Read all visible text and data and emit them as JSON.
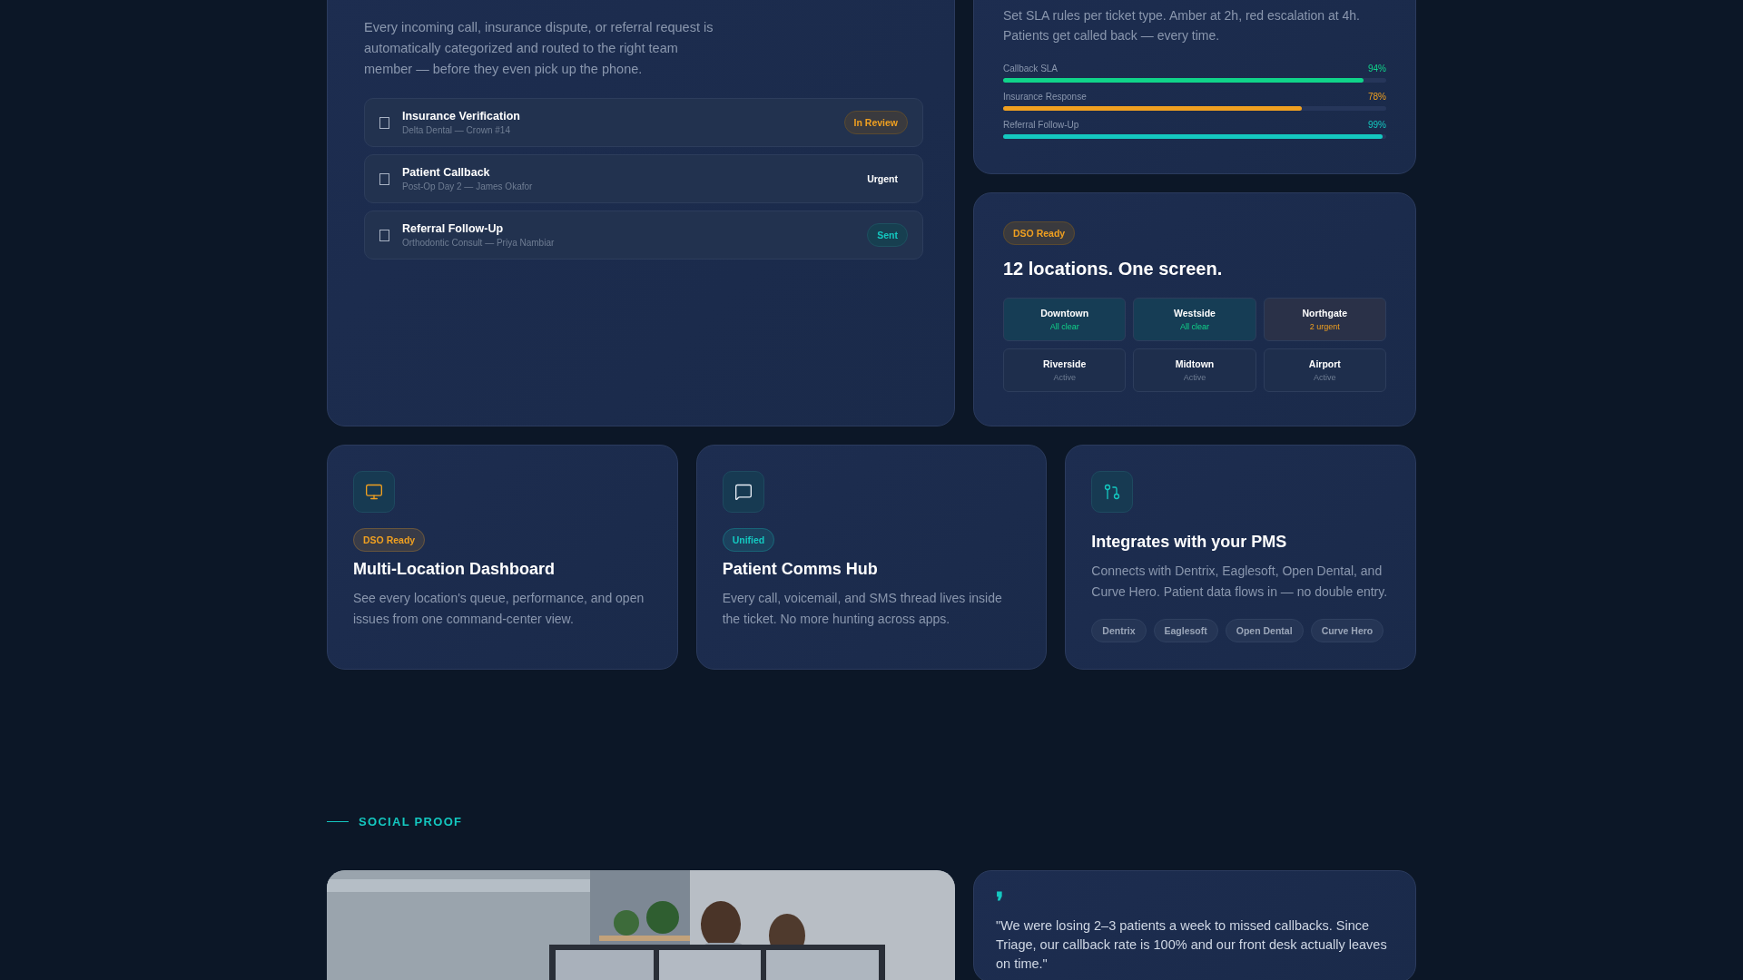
{
  "routing_card": {
    "description": "Every incoming call, insurance dispute, or referral request is automatically categorized and routed to the right team member — before they even pick up the phone.",
    "tickets": [
      {
        "title": "Insurance Verification",
        "subtitle": "Delta Dental — Crown #14",
        "checked": false,
        "status": "In Review",
        "kind": "review"
      },
      {
        "title": "Patient Callback",
        "subtitle": "Post-Op Day 2 — James Okafor",
        "checked": false,
        "status": "Urgent",
        "kind": "urgent"
      },
      {
        "title": "Referral Follow-Up",
        "subtitle": "Orthodontic Consult — Priya Nambiar",
        "checked": false,
        "status": "Sent",
        "kind": "sent"
      }
    ]
  },
  "sla_card": {
    "description": "Set SLA rules per ticket type. Amber at 2h, red escalation at 4h. Patients get called back — every time.",
    "meters": [
      {
        "label": "Callback SLA",
        "reading": "94%",
        "level": 0.94,
        "color": "#10d48a"
      },
      {
        "label": "Insurance Response",
        "reading": "78%",
        "level": 0.78,
        "color": "#f0a020"
      },
      {
        "label": "Referral Follow-Up",
        "reading": "99%",
        "level": 0.99,
        "color": "#14c8c0"
      }
    ]
  },
  "locations_card": {
    "badge": "DSO Ready",
    "title": "12 locations. One screen.",
    "locations": [
      {
        "name": "Downtown",
        "status": "All clear",
        "kind": "clear"
      },
      {
        "name": "Westside",
        "status": "All clear",
        "kind": "clear"
      },
      {
        "name": "Northgate",
        "status": "2 urgent",
        "kind": "urgent"
      },
      {
        "name": "Riverside",
        "status": "Active",
        "kind": "active"
      },
      {
        "name": "Midtown",
        "status": "Active",
        "kind": "active"
      },
      {
        "name": "Airport",
        "status": "Active",
        "kind": "active"
      }
    ]
  },
  "features": [
    {
      "badge": {
        "text": "DSO Ready",
        "color": "#f0a020"
      },
      "title": "Multi-Location Dashboard",
      "description": "See every location's queue, performance, and open issues from one command-center view."
    },
    {
      "badge": {
        "text": "Unified",
        "color": "#14c8c0"
      },
      "title": "Patient Comms Hub",
      "description": "Every call, voicemail, and SMS thread lives inside the ticket. No more hunting across apps."
    },
    {
      "title": "Integrates with your PMS",
      "description": "Connects with Dentrix, Eaglesoft, Open Dental, and Curve Hero. Patient data flows in — no double entry.",
      "tags": [
        "Dentrix",
        "Eaglesoft",
        "Open Dental",
        "Curve Hero"
      ]
    }
  ],
  "social_proof": {
    "eyebrow": "SOCIAL PROOF",
    "quote_mark": "❜",
    "quote": "\"We were losing 2–3 patients a week to missed callbacks. Since Triage, our callback rate is 100% and our front desk actually leaves on time.\""
  }
}
